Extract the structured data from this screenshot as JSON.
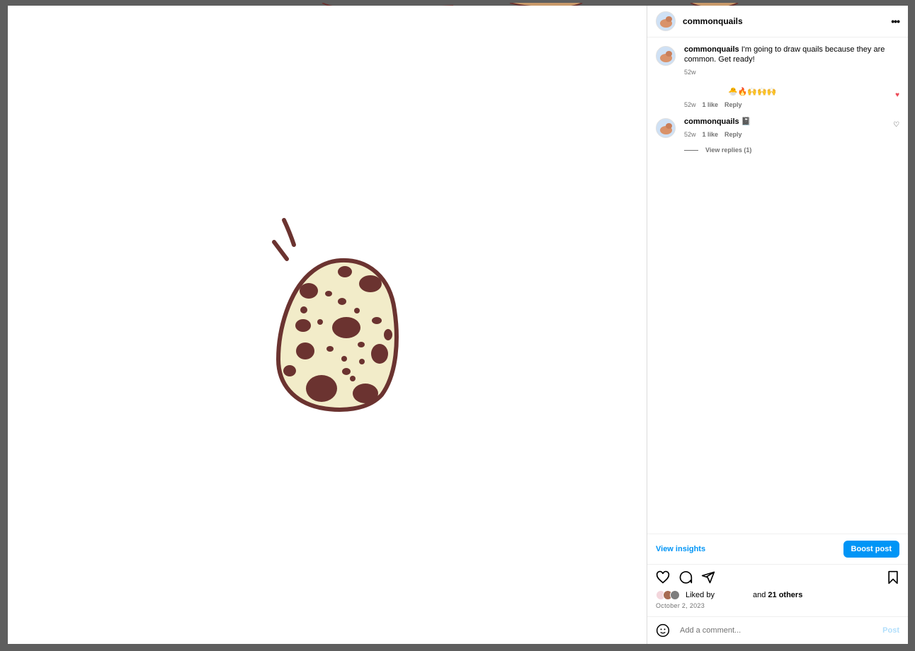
{
  "post": {
    "username": "commonquails",
    "more_icon": "more-horizontal-icon"
  },
  "comments": [
    {
      "username": "commonquails",
      "text": "I'm going to draw quails because they are common. Get ready!",
      "time": "52w"
    },
    {
      "text": "🐣🔥🙌🙌🙌",
      "time": "52w",
      "likes": "1 like",
      "reply": "Reply",
      "liked": true
    },
    {
      "username": "commonquails",
      "text": "📓",
      "time": "52w",
      "likes": "1 like",
      "reply": "Reply",
      "liked": false,
      "view_replies": "View replies (1)"
    }
  ],
  "insights": {
    "view_insights": "View insights",
    "boost_post": "Boost post"
  },
  "likes": {
    "liked_by": "Liked by",
    "and": "and",
    "others": "21 others",
    "date": "October 2, 2023"
  },
  "add_comment": {
    "placeholder": "Add a comment...",
    "post_label": "Post"
  },
  "colors": {
    "accent": "#0095f6",
    "like_red": "#ed4956",
    "egg_fill": "#f2ecc9",
    "egg_spots": "#6b3330"
  }
}
